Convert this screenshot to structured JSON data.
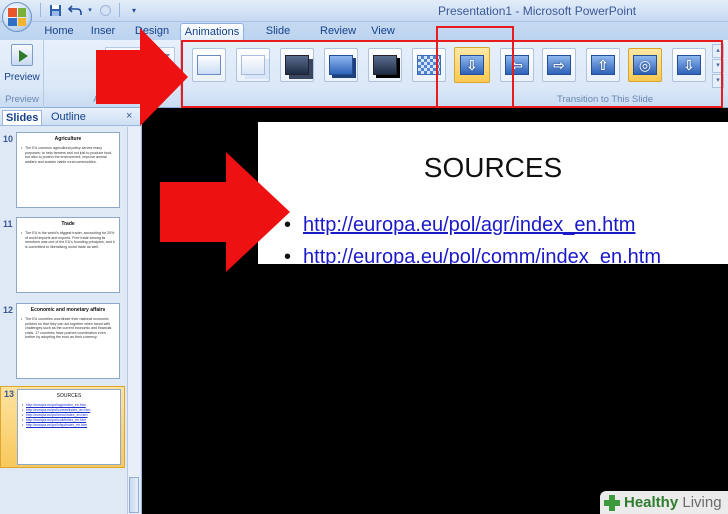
{
  "window": {
    "title": "Presentation1 - Microsoft PowerPoint"
  },
  "quick_access": {
    "icons": [
      "save-icon",
      "undo-icon",
      "redo-icon",
      "customize-icon"
    ]
  },
  "tabs": [
    {
      "label": "Home",
      "active": false
    },
    {
      "label": "Inser",
      "active": false
    },
    {
      "label": "Design",
      "active": false
    },
    {
      "label": "Animations",
      "active": true
    },
    {
      "label": "Slide Show",
      "active": false
    },
    {
      "label": "Review",
      "active": false
    },
    {
      "label": "View",
      "active": false
    }
  ],
  "ribbon": {
    "preview_label": "Preview",
    "preview_group_label": "Preview",
    "animations_group_label": "Ani",
    "transition_group_label": "Transition to This Slide",
    "selected_transition_index": 7
  },
  "slides_panel": {
    "tab_slides": "Slides",
    "tab_outline": "Outline",
    "close_glyph": "×",
    "slides": [
      {
        "number": "10",
        "title": "Agriculture",
        "bullets": [
          "The EU common agricultural policy serves many purposes: to help farmers and not just to produce food, but also to protect the environment, improve animal welfare and sustain viable rural communities."
        ]
      },
      {
        "number": "11",
        "title": "Trade",
        "bullets": [
          "The EU is the world's biggest trader, accounting for 20% of world imports and exports. Free trade among its members was one of the EU's founding principles, and it is committed to liberalising world trade as well."
        ]
      },
      {
        "number": "12",
        "title": "Economic and monetary affairs",
        "bullets": [
          "The EU countries coordinate their national economic policies so that they can act together when faced with challenges such as the current economic and financial crisis. 17 countries have pushed coordination even further by adopting the euro as their currency."
        ]
      },
      {
        "number": "13",
        "title": "SOURCES",
        "links": [
          "http://europa.eu/pol/agr/index_en.htm",
          "http://europa.eu/pol/comm/index_en.htm",
          "http://europa.eu/pol/emu/index_en.htm",
          "http://europa.eu/pol/cult/index_en.htm",
          "http://europa.eu/pol/cfsp/index_en.htm"
        ],
        "selected": true
      }
    ]
  },
  "slide": {
    "title": "SOURCES",
    "links": [
      "http://europa.eu/pol/agr/index_en.htm",
      "http://europa.eu/pol/comm/index_en.htm"
    ]
  },
  "watermark": {
    "brand_a": "Healthy",
    "brand_b": " Living"
  },
  "colors": {
    "highlight_red": "#e81c1c",
    "ribbon_blue": "#dbe8f7",
    "selection_gold": "#f8c95d"
  }
}
